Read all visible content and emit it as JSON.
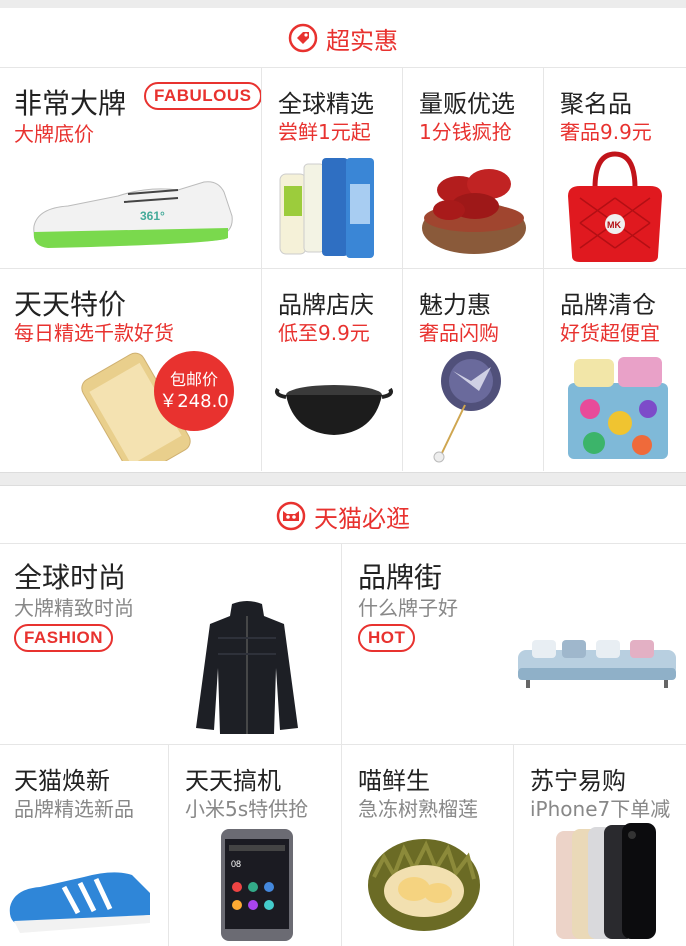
{
  "sections": [
    {
      "title": "超实惠",
      "icon": "tag-icon",
      "tiles": [
        {
          "title": "非常大牌",
          "subtitle": "大牌底价",
          "tag": "FABULOUS",
          "image": "sneaker-image"
        },
        {
          "title": "全球精选",
          "subtitle": "尝鲜1元起",
          "image": "skincare-bottles-image"
        },
        {
          "title": "量贩优选",
          "subtitle": "1分钱疯抢",
          "image": "red-dates-image"
        },
        {
          "title": "聚名品",
          "subtitle": "奢品9.9元",
          "image": "handbag-image"
        },
        {
          "title": "天天特价",
          "subtitle": "每日精选千款好货",
          "image": "phone-image",
          "badge": {
            "label": "包邮价",
            "price": "￥248.0"
          }
        },
        {
          "title": "品牌店庆",
          "subtitle": "低至9.9元",
          "image": "wok-image"
        },
        {
          "title": "魅力惠",
          "subtitle": "奢品闪购",
          "image": "brooch-image"
        },
        {
          "title": "品牌清仓",
          "subtitle": "好货超便宜",
          "image": "bedding-image"
        }
      ]
    },
    {
      "title": "天猫必逛",
      "icon": "tmall-cat-icon",
      "tiles": [
        {
          "title": "全球时尚",
          "subtitle": "大牌精致时尚",
          "tag": "FASHION",
          "image": "jacket-image"
        },
        {
          "title": "品牌街",
          "subtitle": "什么牌子好",
          "tag": "HOT",
          "image": "sofa-image"
        },
        {
          "title": "天猫焕新",
          "subtitle": "品牌精选新品",
          "image": "football-boot-image"
        },
        {
          "title": "天天搞机",
          "subtitle": "小米5s特供抢",
          "image": "xiaomi-phone-image"
        },
        {
          "title": "喵鲜生",
          "subtitle": "急冻树熟榴莲",
          "image": "durian-image"
        },
        {
          "title": "苏宁易购",
          "subtitle": "iPhone7下单减",
          "image": "iphone-image"
        }
      ]
    }
  ],
  "colors": {
    "accent": "#e8322f",
    "separator": "#ececec"
  }
}
